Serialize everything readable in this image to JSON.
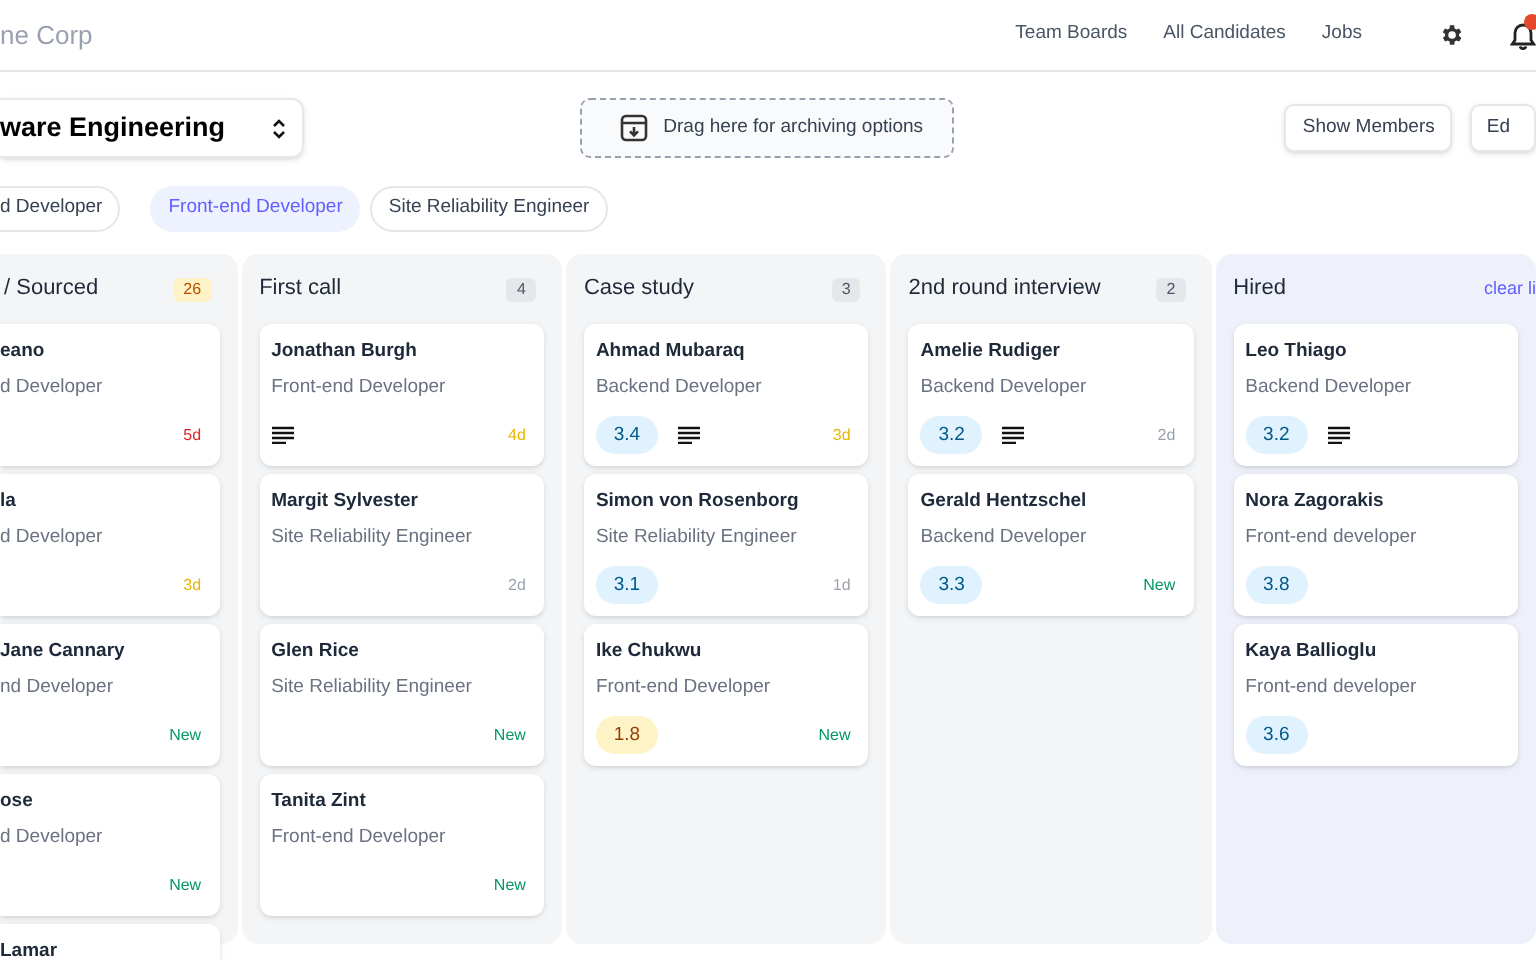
{
  "header": {
    "brand": "ne Corp",
    "nav": [
      "Team Boards",
      "All Candidates",
      "Jobs"
    ],
    "notifications_badge": true
  },
  "toolbar": {
    "board_title": "ware Engineering",
    "drop_zone": "Drag here for archiving options",
    "buttons": [
      "Show Members",
      "Ed"
    ]
  },
  "tabs": [
    {
      "label": "d Developer",
      "selected": false
    },
    {
      "label": "Front-end Developer",
      "selected": true
    },
    {
      "label": "Site Reliability Engineer",
      "selected": false
    }
  ],
  "columns": [
    {
      "title": "/ Sourced",
      "count": "26",
      "count_warning": true,
      "color": "#f4f5f7",
      "cards": [
        {
          "name": "eano",
          "role": "d Developer",
          "age": {
            "text": "5d",
            "color": "#dc2626"
          }
        },
        {
          "name": "la",
          "role": "d Developer",
          "age": {
            "text": "3d",
            "color": "#eab308"
          }
        },
        {
          "name": "Jane Cannary",
          "role": "nd Developer",
          "age": {
            "text": "New",
            "color": "#059669"
          }
        },
        {
          "name": "ose",
          "role": "d Developer",
          "age": {
            "text": "New",
            "color": "#059669"
          }
        },
        {
          "name": "Lamar"
        }
      ]
    },
    {
      "title": "First call",
      "count": "4",
      "count_warning": false,
      "color": "#f4f5f7",
      "cards": [
        {
          "name": "Jonathan Burgh",
          "role": "Front-end Developer",
          "has_notes": true,
          "age": {
            "text": "4d",
            "color": "#eab308"
          }
        },
        {
          "name": "Margit Sylvester",
          "role": "Site Reliability Engineer",
          "age": {
            "text": "2d",
            "color": "#9ca3af"
          }
        },
        {
          "name": "Glen Rice",
          "role": "Site Reliability Engineer",
          "age": {
            "text": "New",
            "color": "#059669"
          }
        },
        {
          "name": "Tanita Zint",
          "role": "Front-end Developer",
          "age": {
            "text": "New",
            "color": "#059669"
          }
        }
      ]
    },
    {
      "title": "Case study",
      "count": "3",
      "count_warning": false,
      "color": "#f4f5f7",
      "cards": [
        {
          "name": "Ahmad Mubaraq",
          "role": "Backend Developer",
          "score": "3.4",
          "score_low": false,
          "has_notes": true,
          "age": {
            "text": "3d",
            "color": "#eab308"
          }
        },
        {
          "name": "Simon von Rosenborg",
          "role": "Site Reliability Engineer",
          "score": "3.1",
          "score_low": false,
          "age": {
            "text": "1d",
            "color": "#9ca3af"
          }
        },
        {
          "name": "Ike Chukwu",
          "role": "Front-end Developer",
          "score": "1.8",
          "score_low": true,
          "age": {
            "text": "New",
            "color": "#059669"
          }
        }
      ]
    },
    {
      "title": "2nd round interview",
      "count": "2",
      "count_warning": false,
      "color": "#f4f5f7",
      "cards": [
        {
          "name": "Amelie Rudiger",
          "role": "Backend Developer",
          "score": "3.2",
          "score_low": false,
          "has_notes": true,
          "age": {
            "text": "2d",
            "color": "#9ca3af"
          }
        },
        {
          "name": "Gerald Hentzschel",
          "role": "Backend Developer",
          "score": "3.3",
          "score_low": false,
          "age": {
            "text": "New",
            "color": "#059669"
          }
        }
      ]
    },
    {
      "title": "Hired",
      "action": "clear li",
      "color": "#eef0fa",
      "cards": [
        {
          "name": "Leo Thiago",
          "role": "Backend Developer",
          "score": "3.2",
          "score_low": false,
          "has_notes": true
        },
        {
          "name": "Nora Zagorakis",
          "role": "Front-end developer",
          "score": "3.8",
          "score_low": false
        },
        {
          "name": "Kaya Ballioglu",
          "role": "Front-end developer",
          "score": "3.6",
          "score_low": false
        }
      ]
    }
  ]
}
